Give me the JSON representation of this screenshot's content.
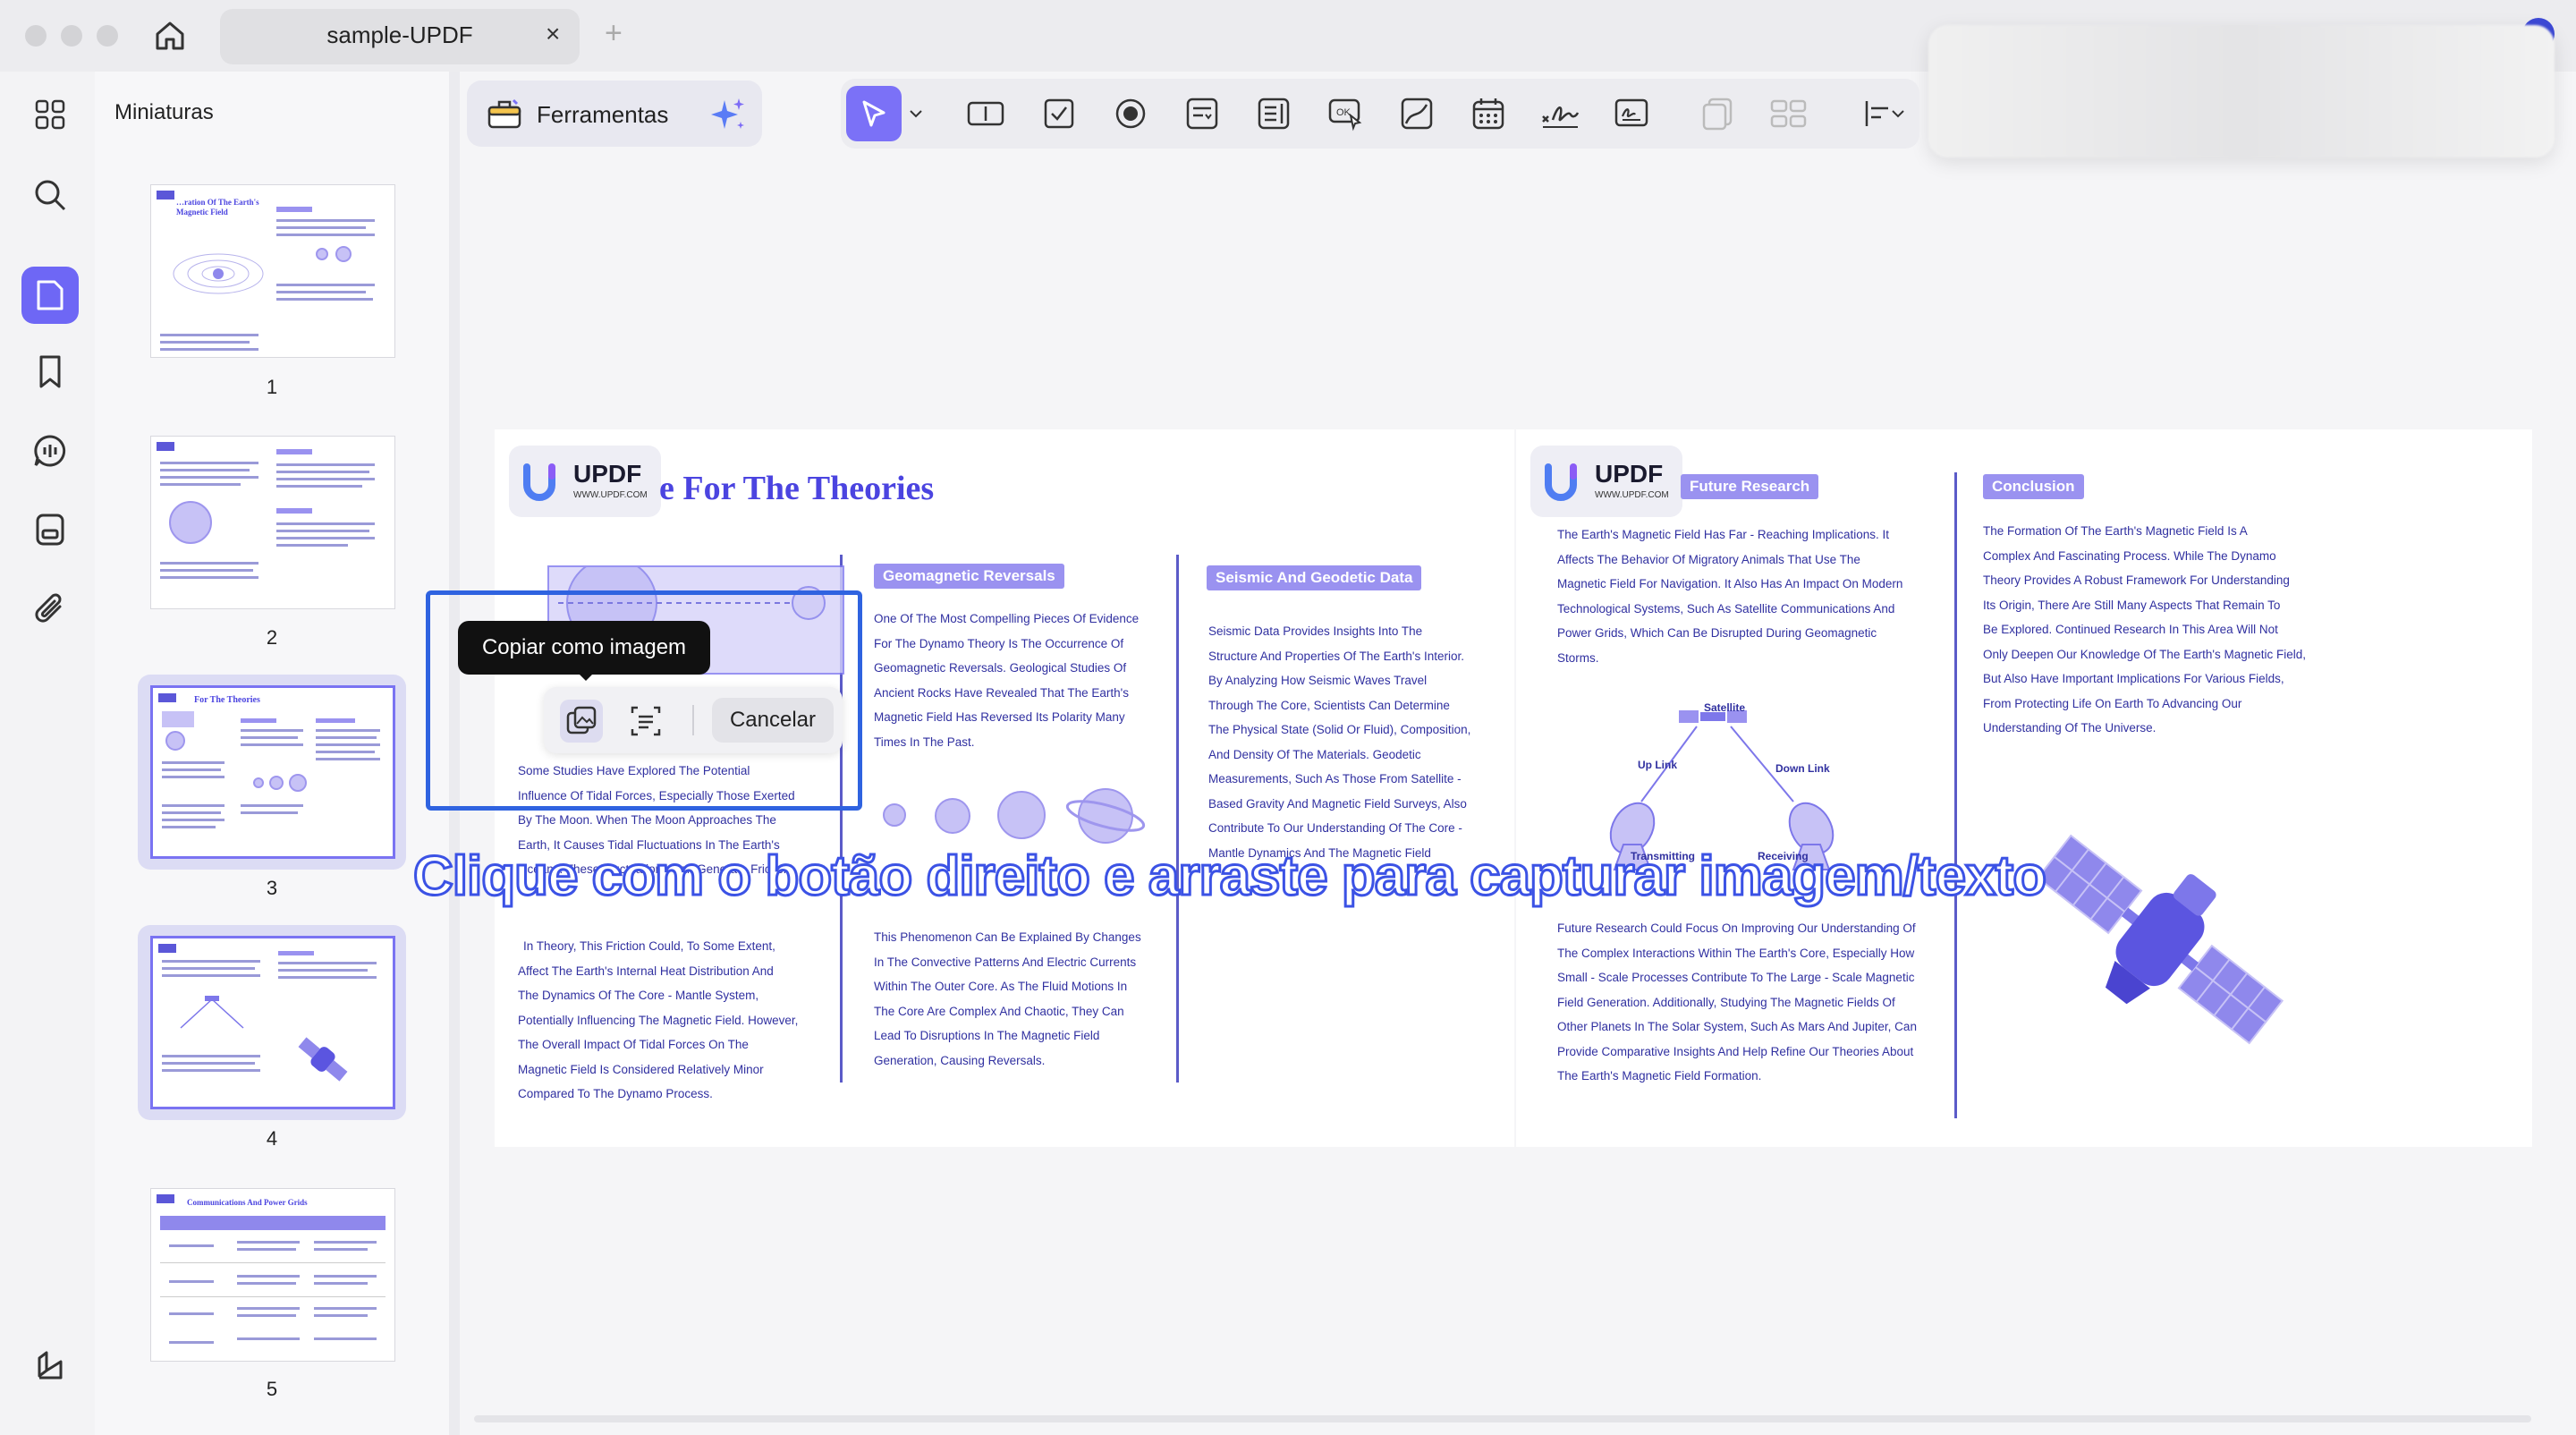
{
  "window": {
    "tab_title": "sample-UPDF",
    "tab_close": "×",
    "tab_add": "+"
  },
  "sidebar": {
    "panel_title": "Miniaturas",
    "thumbnails": [
      {
        "num": "1",
        "title": "…ration Of The Earth's Magnetic Field"
      },
      {
        "num": "2",
        "title": ""
      },
      {
        "num": "3",
        "title": "For The Theories"
      },
      {
        "num": "4",
        "title": ""
      },
      {
        "num": "5",
        "title": "Communications And Power Grids"
      }
    ]
  },
  "toolbar": {
    "tools_label": "Ferramentas"
  },
  "document": {
    "logo_name": "UPDF",
    "logo_url": "WWW.UPDF.COM",
    "heading": "e For The Theories",
    "col1_text": [
      "Some Studies Have Explored The Potential",
      "Influence Of Tidal Forces, Especially Those Exerted",
      "By The Moon. When The Moon Approaches The",
      "Earth, It Causes Tidal Fluctuations In The Earth's",
      "Oceans. These Fluctuations Can Generate Friction"
    ],
    "col1_text2": [
      "In Theory, This Friction Could, To Some Extent,",
      "Affect The Earth's Internal Heat Distribution And",
      "The Dynamics Of The Core - Mantle System,",
      "Potentially Influencing The Magnetic Field. However,",
      "The Overall Impact Of Tidal Forces On The",
      "Magnetic Field Is Considered Relatively Minor",
      "Compared To The Dynamo Process."
    ],
    "col2_badge": "Geomagnetic Reversals",
    "col2_text": [
      "One Of The Most Compelling Pieces Of Evidence",
      "For The Dynamo Theory Is The Occurrence Of",
      "Geomagnetic Reversals. Geological Studies Of",
      "Ancient Rocks Have Revealed That The Earth's",
      "Magnetic Field Has Reversed Its Polarity Many",
      "Times In The Past."
    ],
    "col2_text2": [
      "This Phenomenon Can Be Explained By Changes",
      "In The Convective Patterns And Electric Currents",
      "Within The Outer Core. As The Fluid Motions In",
      "The Core Are Complex And Chaotic, They Can",
      "Lead To Disruptions In The Magnetic Field",
      "Generation, Causing Reversals."
    ],
    "col3_badge": "Seismic And Geodetic Data",
    "col3_text": [
      "Seismic Data Provides Insights Into The",
      "Structure And Properties Of The Earth's Interior.",
      "By Analyzing How Seismic Waves Travel",
      "Through The Core, Scientists Can Determine",
      "The Physical State (Solid Or Fluid), Composition,",
      "And Density Of The Materials. Geodetic",
      "Measurements, Such As Those From Satellite -",
      "Based Gravity And Magnetic Field Surveys, Also",
      "Contribute To Our Understanding Of The Core -",
      "Mantle Dynamics And The Magnetic Field"
    ],
    "col4_badge": "Future Research",
    "col4_text": [
      "The Earth's Magnetic Field Has Far - Reaching Implications. It",
      "Affects The Behavior Of Migratory Animals That Use The",
      "Magnetic Field For Navigation. It Also Has An Impact On Modern",
      "Technological Systems, Such As Satellite Communications And",
      "Power Grids, Which Can Be Disrupted During Geomagnetic",
      "Storms."
    ],
    "col4_text2": [
      "Future Research Could Focus On Improving Our Understanding Of",
      "The Complex Interactions Within The Earth's Core, Especially How",
      "Small - Scale Processes Contribute To The Large - Scale Magnetic",
      "Field Generation. Additionally, Studying The Magnetic Fields Of",
      "Other Planets In The Solar System, Such As Mars And Jupiter, Can",
      "Provide Comparative Insights And Help Refine Our Theories About",
      "The Earth's Magnetic Field Formation."
    ],
    "diagram": {
      "satellite": "Satellite",
      "uplink": "Up Link",
      "downlink": "Down Link",
      "transmitting": "Transmitting",
      "receiving": "Receiving"
    },
    "col5_badge": "Conclusion",
    "col5_text": [
      "The Formation Of The Earth's Magnetic Field Is A",
      "Complex And Fascinating Process. While The Dynamo",
      "Theory Provides A Robust Framework For Understanding",
      "Its Origin, There Are Still Many Aspects That Remain To",
      "Be Explored. Continued Research In This Area Will Not",
      "Only Deepen Our Knowledge Of The Earth's Magnetic Field,",
      "But Also Have Important Implications For Various Fields,",
      "From Protecting Life On Earth To Advancing Our",
      "Understanding Of The Universe."
    ]
  },
  "capture": {
    "tooltip": "Copiar como imagem",
    "cancel_label": "Cancelar"
  },
  "caption": "Clique com o botão direito e arraste para capturar imagem/texto",
  "colors": {
    "accent": "#6e67f5",
    "capture_border": "#2f63e0",
    "doc_text": "#3030a0",
    "heading": "#4b44e0"
  }
}
